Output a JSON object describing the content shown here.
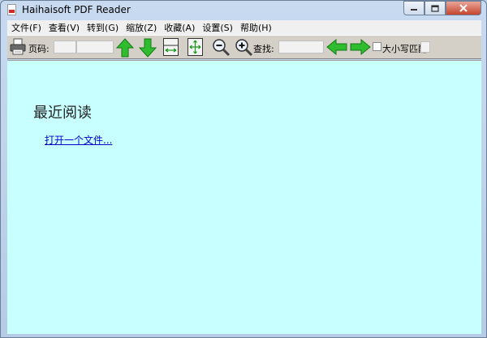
{
  "window": {
    "title": "Haihaisoft PDF Reader",
    "controls": [
      "minimize",
      "maximize",
      "close"
    ]
  },
  "menu": {
    "items": [
      "文件(F)",
      "查看(V)",
      "转到(G)",
      "缩放(Z)",
      "收藏(A)",
      "设置(S)",
      "帮助(H)"
    ]
  },
  "toolbar": {
    "page_label": "页码:",
    "page_value": "",
    "page_total": "",
    "find_label": "查找:",
    "find_value": "",
    "match_case_label": "大小写匹配",
    "match_case_checked": false,
    "icons": [
      "printer-icon",
      "page-up-icon",
      "page-down-icon",
      "fit-width-icon",
      "fit-page-icon",
      "zoom-out-icon",
      "zoom-in-icon",
      "find-prev-icon",
      "find-next-icon"
    ]
  },
  "main": {
    "heading": "最近阅读",
    "open_link": "打开一个文件..."
  },
  "colors": {
    "content_bg": "#c8ffff",
    "toolbar_bg": "#d4d0c8",
    "arrow_green": "#2fbd2f",
    "link": "#0000cc"
  }
}
